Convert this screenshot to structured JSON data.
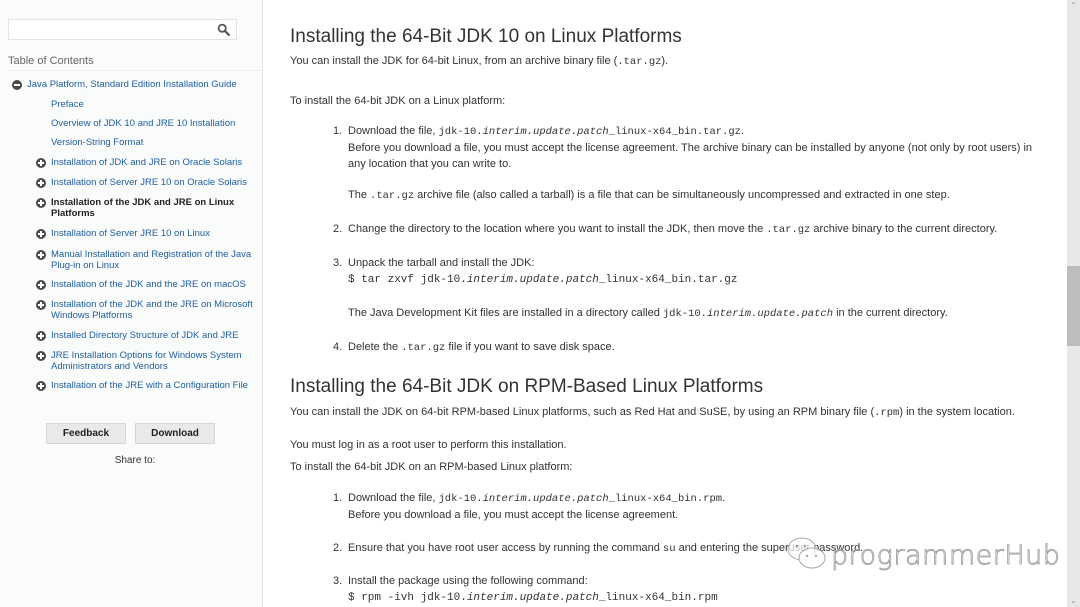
{
  "sidebar": {
    "search": {
      "placeholder": "",
      "value": ""
    },
    "toc_title": "Table of Contents",
    "toc": [
      {
        "label": "Java Platform, Standard Edition Installation Guide",
        "icon": "minus-circle-icon",
        "level": 0
      },
      {
        "label": "Preface",
        "icon": "",
        "level": 1
      },
      {
        "label": "Overview of JDK 10 and JRE 10 Installation",
        "icon": "",
        "level": 1
      },
      {
        "label": "Version-String Format",
        "icon": "",
        "level": 1
      },
      {
        "label": "Installation of JDK and JRE on Oracle Solaris",
        "icon": "plus-circle-icon",
        "level": 1
      },
      {
        "label": "Installation of Server JRE 10 on Oracle Solaris",
        "icon": "plus-circle-icon",
        "level": 1
      },
      {
        "label_line1": "Installation of the JDK and JRE on Linux",
        "label_line2": "Platforms",
        "icon": "plus-circle-icon",
        "level": 1,
        "active": true
      },
      {
        "label": "Installation of Server JRE 10 on Linux",
        "icon": "plus-circle-icon",
        "level": 1
      },
      {
        "label_line1": "Manual Installation and Registration of the Java",
        "label_line2": "Plug-in on Linux",
        "icon": "plus-circle-icon",
        "level": 1
      },
      {
        "label": "Installation of the JDK and the JRE on macOS",
        "icon": "plus-circle-icon",
        "level": 1
      },
      {
        "label_line1": "Installation of the JDK and the JRE on Microsoft",
        "label_line2": "Windows Platforms",
        "icon": "plus-circle-icon",
        "level": 1
      },
      {
        "label": "Installed Directory Structure of JDK and JRE",
        "icon": "plus-circle-icon",
        "level": 1
      },
      {
        "label_line1": "JRE Installation Options for Windows System",
        "label_line2": "Administrators and Vendors",
        "icon": "plus-circle-icon",
        "level": 1
      },
      {
        "label": "Installation of the JRE with a Configuration File",
        "icon": "plus-circle-icon",
        "level": 1
      }
    ],
    "buttons": {
      "feedback": "Feedback",
      "download": "Download"
    },
    "share_label": "Share to:"
  },
  "main": {
    "section1": {
      "title": "Installing the 64-Bit JDK 10 on Linux Platforms",
      "intro_pre": "You can install the JDK for 64-bit Linux, from an archive binary file (",
      "intro_code": ".tar.gz",
      "intro_post": ").",
      "lead": "To install the 64-bit JDK on a Linux platform:",
      "steps": [
        {
          "num": "1.",
          "text_pre": "Download the file, ",
          "code_a": "jdk-10.",
          "code_i": "interim.update.patch",
          "code_b": "_linux-x64_bin.tar.gz",
          "text_post": ".",
          "note_line1": "Before you download a file, you must accept the license agreement. The archive binary can be installed by anyone (not only by root users) in",
          "note_line2": "any location that you can write to.",
          "extra_pre": "The ",
          "extra_code": ".tar.gz",
          "extra_post": " archive file (also called a tarball) is a file that can be simultaneously uncompressed and extracted in one step."
        },
        {
          "num": "2.",
          "text_pre": "Change the directory to the location where you want to install the JDK, then move the ",
          "code": ".tar.gz",
          "text_post": " archive binary to the current directory."
        },
        {
          "num": "3.",
          "text": "Unpack the tarball and install the JDK:",
          "cmd_a": "$ tar zxvf jdk-10.",
          "cmd_i": "interim.update.patch",
          "cmd_b": "_linux-x64_bin.tar.gz",
          "note_pre": "The Java Development Kit files are installed in a directory called ",
          "note_code_a": "jdk-10.",
          "note_code_i": "interim.update.patch",
          "note_post": " in the current directory."
        },
        {
          "num": "4.",
          "text_pre": "Delete the ",
          "code": ".tar.gz",
          "text_post": " file if you want to save disk space."
        }
      ]
    },
    "section2": {
      "title": "Installing the 64-Bit JDK on RPM-Based Linux Platforms",
      "intro_pre": "You can install the JDK on 64-bit RPM-based Linux platforms, such as Red Hat and SuSE, by using an RPM binary file (",
      "intro_code": ".rpm",
      "intro_post": ") in the system location.",
      "root_note": "You must log in as a root user to perform this installation.",
      "lead": "To install the 64-bit JDK on an RPM-based Linux platform:",
      "steps": [
        {
          "num": "1.",
          "text_pre": "Download the file, ",
          "code_a": "jdk-10.",
          "code_i": "interim.update.patch",
          "code_b": "_linux-x64_bin.rpm",
          "text_post": ".",
          "note": "Before you download a file, you must accept the license agreement."
        },
        {
          "num": "2.",
          "text_pre": "Ensure that you have root user access by running the command ",
          "code": "su",
          "text_post": " and entering the superuser password."
        },
        {
          "num": "3.",
          "text": "Install the package using the following command:",
          "cmd_a": "$ rpm -ivh jdk-10.",
          "cmd_i": "interim.update.patch",
          "cmd_b": "_linux-x64_bin.rpm"
        }
      ]
    }
  },
  "watermark": {
    "text": "programmerHub",
    "icon": "wechat-icon"
  },
  "scrollbar": {
    "position_fraction": 0.45
  }
}
